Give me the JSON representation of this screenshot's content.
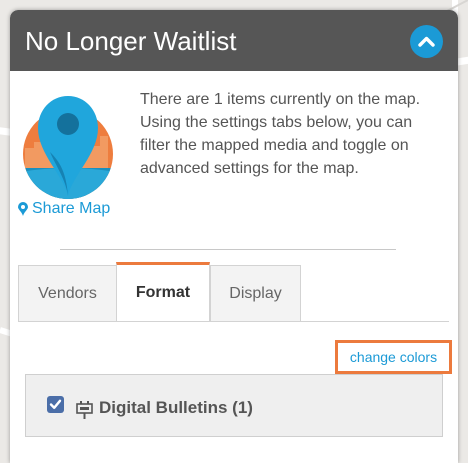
{
  "panel": {
    "title": "No Longer Waitlist",
    "collapse_icon": "chevron-up-icon"
  },
  "intro": {
    "description": "There are 1 items currently on the map. Using the settings tabs below, you can filter the mapped media and toggle on advanced settings for the map.",
    "share_label": "Share Map",
    "share_icon": "map-marker-icon"
  },
  "tabs": [
    {
      "label": "Vendors",
      "active": false
    },
    {
      "label": "Format",
      "active": true
    },
    {
      "label": "Display",
      "active": false
    }
  ],
  "format": {
    "change_colors_label": "change colors",
    "media_items": [
      {
        "label": "Digital Bulletins (1)",
        "checked": true,
        "icon": "billboard-icon"
      }
    ]
  },
  "colors": {
    "header": "#565656",
    "accent_blue": "#1b9ad6",
    "highlight_orange": "#ec7a3d"
  }
}
